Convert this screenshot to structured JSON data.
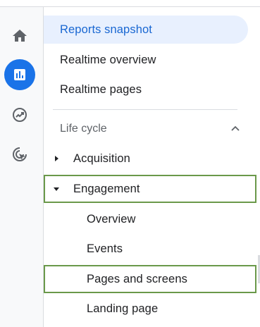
{
  "rail": {
    "items": [
      {
        "icon": "home-icon",
        "active": false
      },
      {
        "icon": "reports-bar-chart-icon",
        "active": true
      },
      {
        "icon": "explore-trend-icon",
        "active": false
      },
      {
        "icon": "advertising-cursor-icon",
        "active": false
      }
    ],
    "accent": "#1a73e8"
  },
  "menu": {
    "top_items": [
      "Reports snapshot",
      "Realtime overview",
      "Realtime pages"
    ],
    "section_label": "Life cycle",
    "groups": [
      {
        "label": "Acquisition",
        "expanded": false
      },
      {
        "label": "Engagement",
        "expanded": true,
        "children": [
          "Overview",
          "Events",
          "Pages and screens",
          "Landing page"
        ]
      }
    ]
  },
  "colors": {
    "active_bg": "#e8f0fe",
    "active_text": "#1967d2",
    "highlight_outline": "#6a994a"
  }
}
